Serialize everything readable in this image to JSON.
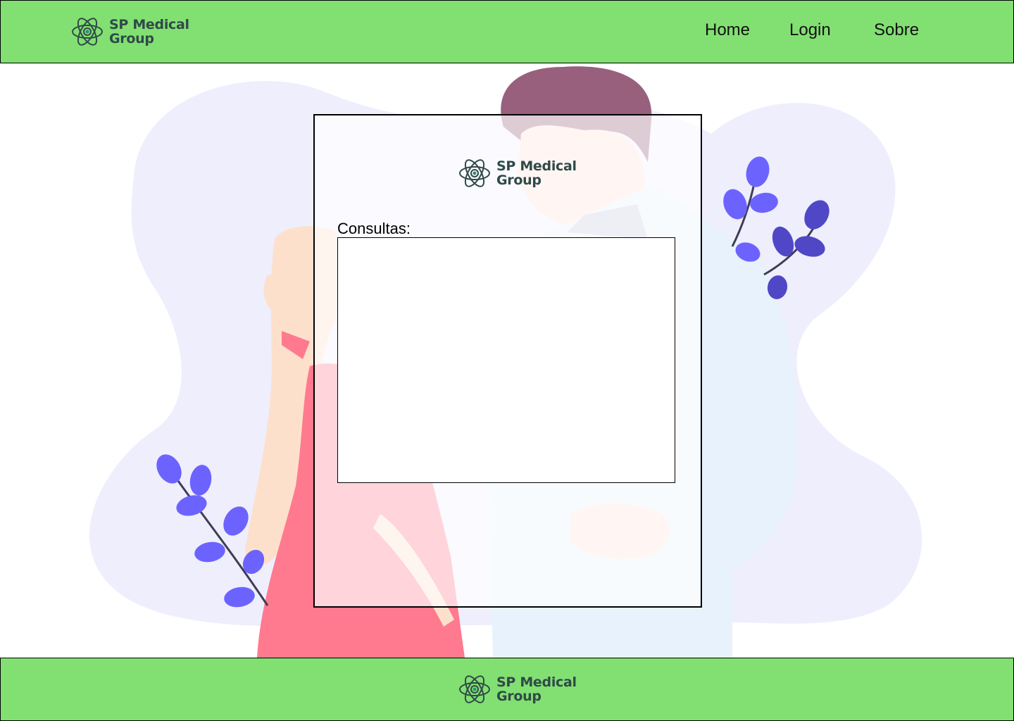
{
  "brand": {
    "line1": "SP Medical",
    "line2": "Group",
    "logo_icon": "atom-icon"
  },
  "nav": [
    {
      "label": "Home"
    },
    {
      "label": "Login"
    },
    {
      "label": "Sobre"
    }
  ],
  "main": {
    "consultas_label": "Consultas:",
    "consultas_list": []
  },
  "colors": {
    "header_bg": "#82e072",
    "blob": "#efeefd",
    "leaf": "#6c63ff",
    "dress": "#ff7a8f"
  }
}
